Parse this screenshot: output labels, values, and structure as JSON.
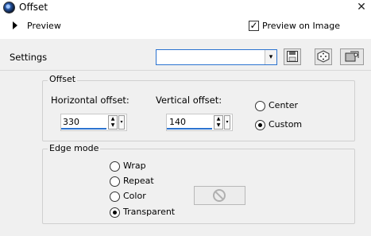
{
  "window": {
    "title": "Offset",
    "close_glyph": "✕"
  },
  "preview": {
    "label": "Preview",
    "preview_on_image_label": "Preview on Image",
    "preview_on_image_checked": true
  },
  "settings": {
    "label": "Settings",
    "value": "",
    "icons": [
      "save-preset-icon",
      "randomize-dice-icon",
      "preset-manager-icon"
    ]
  },
  "offset": {
    "legend": "Offset",
    "horizontal_label": "Horizontal offset:",
    "horizontal_value": "330",
    "vertical_label": "Vertical offset:",
    "vertical_value": "140",
    "center_label": "Center",
    "custom_label": "Custom",
    "selected": "Custom"
  },
  "edge_mode": {
    "legend": "Edge mode",
    "options": [
      "Wrap",
      "Repeat",
      "Color",
      "Transparent"
    ],
    "selected": "Transparent",
    "color_swatch_icon": "no-color-icon"
  },
  "colors": {
    "accent": "#2b73d0",
    "background": "#f0f0f0"
  }
}
